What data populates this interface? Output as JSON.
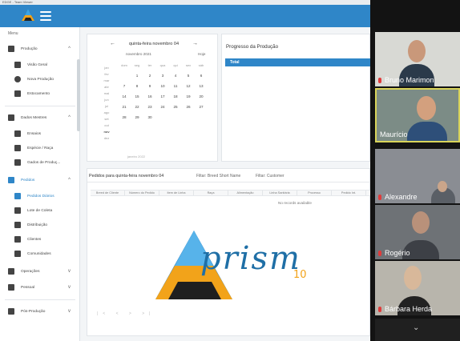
{
  "os": {
    "title": "EDGE - Team Viewer"
  },
  "sidebar": {
    "menu_label": "Menu",
    "items": [
      {
        "label": "Produção",
        "chevron": "^"
      },
      {
        "label": "Visão Geral"
      },
      {
        "label": "Nova Produção"
      },
      {
        "label": "Estocamento"
      },
      {
        "label": "Dados Mestres",
        "chevron": "^"
      },
      {
        "label": "Ensaios"
      },
      {
        "label": "Espécie / Raça"
      },
      {
        "label": "Gados de Produç..."
      },
      {
        "label": "Pedidos",
        "chevron": "^"
      },
      {
        "label": "Pedidos Diários"
      },
      {
        "label": "Lote de Coleta"
      },
      {
        "label": "Distribuição"
      },
      {
        "label": "Clientes"
      },
      {
        "label": "Comunidades"
      },
      {
        "label": "Operações",
        "chevron": "v"
      },
      {
        "label": "Pessoal",
        "chevron": "v"
      },
      {
        "label": "Pós-Produção",
        "chevron": "v"
      }
    ]
  },
  "calendar": {
    "header": "quinta-feira novembro 04",
    "prev_arrow": "←",
    "next_arrow": "→",
    "month_label": "novembro 2021",
    "today_label": "Hoje",
    "left_column": [
      "",
      "jan",
      "fev",
      "mar",
      "abr",
      "mai",
      "jun",
      "jul",
      "ago",
      "set",
      "out",
      "nov",
      "dez"
    ],
    "weekdays": [
      "dom",
      "seg",
      "ter",
      "qua",
      "qui",
      "sex",
      "sáb"
    ],
    "weeks": [
      [
        "",
        "1",
        "2",
        "3",
        "4",
        "5",
        "6"
      ],
      [
        "7",
        "8",
        "9",
        "10",
        "11",
        "12",
        "13"
      ],
      [
        "14",
        "15",
        "16",
        "17",
        "18",
        "19",
        "20"
      ],
      [
        "21",
        "22",
        "23",
        "24",
        "25",
        "26",
        "27"
      ],
      [
        "28",
        "29",
        "30",
        "",
        "",
        "",
        ""
      ]
    ],
    "footer": "janeiro 2022"
  },
  "progress": {
    "title": "Progresso da Produção",
    "bar_label": "Total"
  },
  "orders": {
    "title": "Pedidos para quinta-feira novembro 04",
    "filter1": "Filtar: Breed Short Name",
    "filter2": "Filtar: Customer",
    "columns": [
      "Breed de Cliente",
      "Número do Pedido",
      "Item de Linha",
      "Raça",
      "Alimentação",
      "Linha Sanitária",
      "Processo",
      "Pedido Int."
    ],
    "no_records": "No records available",
    "pager": "|<  <  >  >|"
  },
  "watermark": {
    "text": "prism",
    "subscript": "10"
  },
  "participants": [
    {
      "name": "Bruno Marimon",
      "speaking": false
    },
    {
      "name": "Maurício",
      "speaking": true
    },
    {
      "name": "Alexandre",
      "speaking": false
    },
    {
      "name": "Rogério",
      "speaking": false
    },
    {
      "name": "Bárbara Herda",
      "speaking": false
    }
  ],
  "colors": {
    "brand": "#2f86c8",
    "speaker_border": "#d9d45a",
    "mic_muted": "#e03b3b"
  }
}
